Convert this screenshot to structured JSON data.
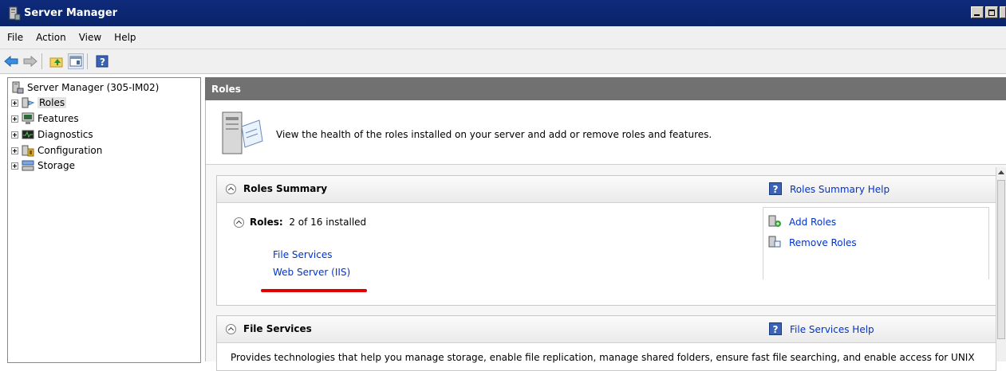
{
  "window": {
    "title": "Server Manager",
    "accent": "#0a246a"
  },
  "menu": {
    "items": [
      "File",
      "Action",
      "View",
      "Help"
    ]
  },
  "toolbar": {
    "buttons": [
      "back-arrow-icon",
      "forward-arrow-icon",
      "up-folder-icon",
      "show-hide-console-tree-icon",
      "help-icon"
    ]
  },
  "tree": {
    "root": "Server Manager (305-IM02)",
    "items": [
      {
        "label": "Roles",
        "icon": "roles-icon",
        "selected": true
      },
      {
        "label": "Features",
        "icon": "features-icon"
      },
      {
        "label": "Diagnostics",
        "icon": "diagnostics-icon"
      },
      {
        "label": "Configuration",
        "icon": "configuration-icon"
      },
      {
        "label": "Storage",
        "icon": "storage-icon"
      }
    ]
  },
  "main": {
    "header": "Roles",
    "description": "View the health of the roles installed on your server and add or remove roles and features.",
    "roles_summary": {
      "title": "Roles Summary",
      "help_link": "Roles Summary Help",
      "roles_label": "Roles:",
      "roles_count": "2 of 16 installed",
      "installed": [
        "File Services",
        "Web Server (IIS)"
      ],
      "actions": [
        "Add Roles",
        "Remove Roles"
      ]
    },
    "file_services": {
      "title": "File Services",
      "help_link": "File Services Help",
      "description": "Provides technologies that help you manage storage, enable file replication, manage shared folders, ensure fast file searching, and enable access for UNIX"
    }
  },
  "colors": {
    "link": "#0033cc",
    "highlight_underline": "#e00000",
    "pane_header": "#717171"
  }
}
